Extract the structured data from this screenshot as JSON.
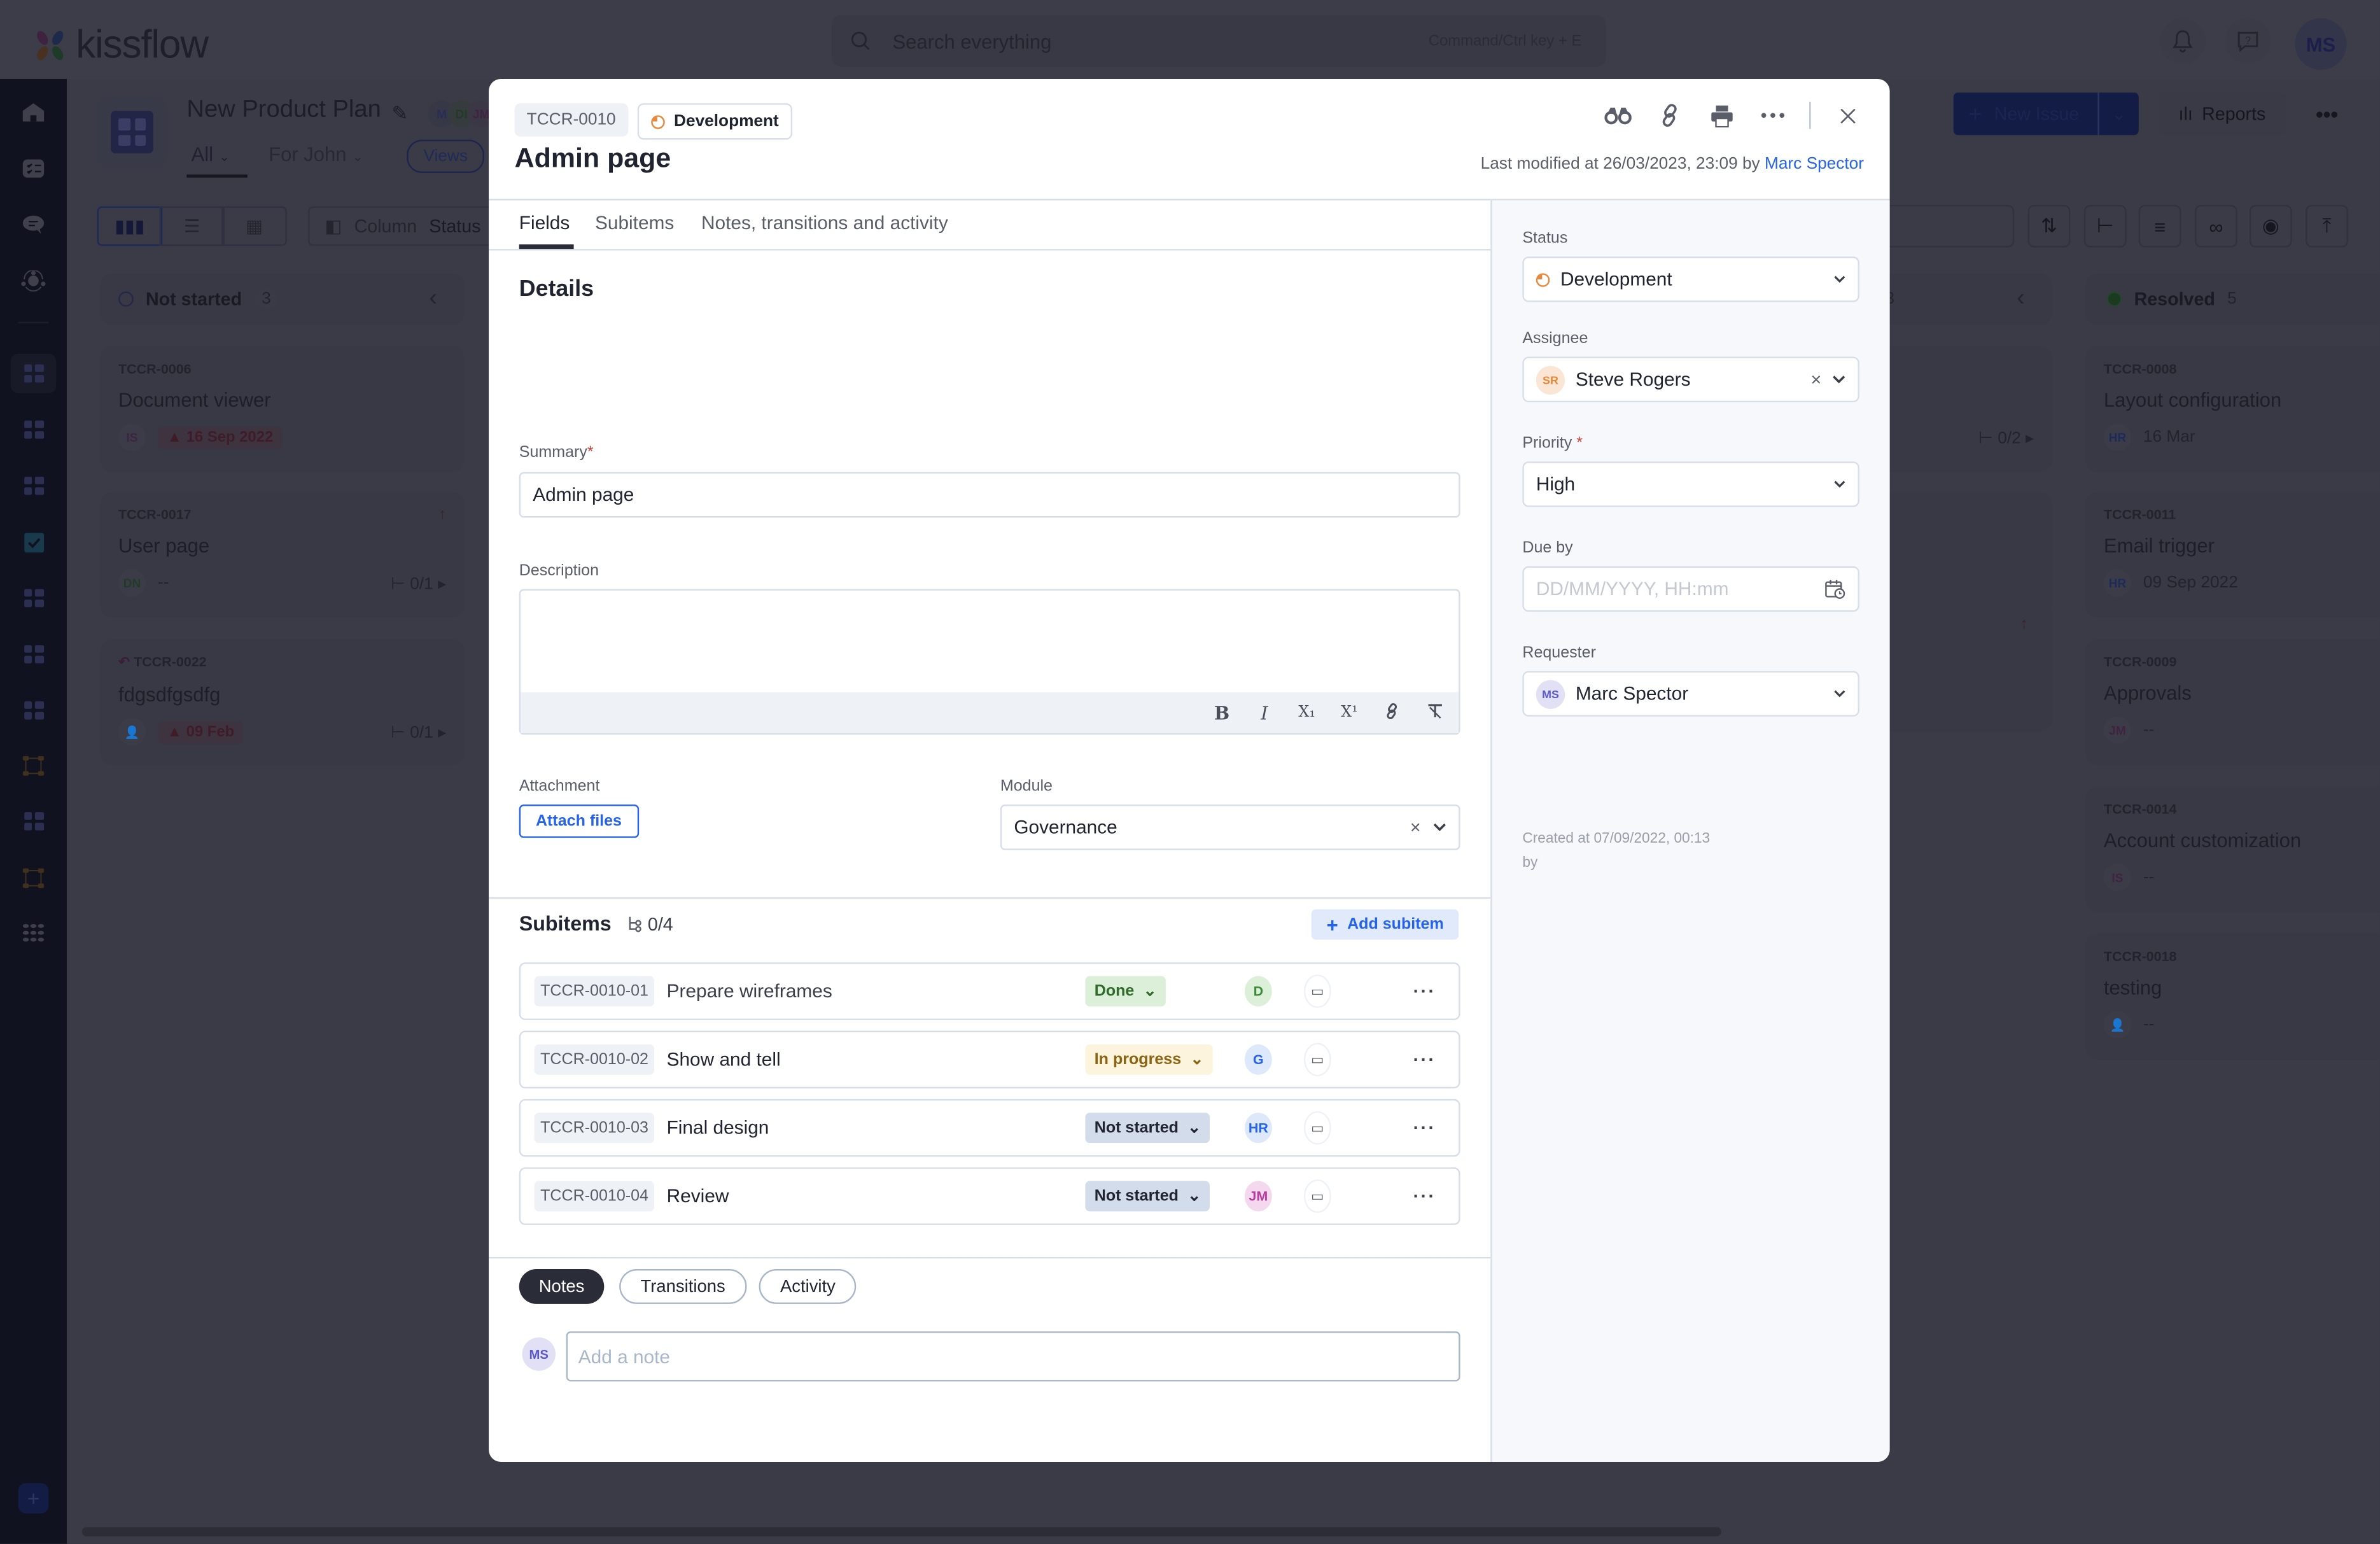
{
  "app": {
    "logo_text": "kissflow",
    "search_placeholder": "Search everything",
    "search_shortcut": "Command/Ctrl key + E",
    "user_initials": "MS",
    "icons": [
      "bell-icon",
      "help-icon"
    ]
  },
  "sidebar": {
    "items": [
      "home",
      "tasks",
      "chat",
      "community",
      "board",
      "board",
      "board",
      "checklist",
      "board",
      "board",
      "board",
      "process",
      "board",
      "process",
      "apps"
    ],
    "add_label": "+"
  },
  "background": {
    "board_title": "New Product Plan",
    "member_initials": [
      "M",
      "DI",
      "JM"
    ],
    "tabs": [
      "All",
      "For John"
    ],
    "views_label": "Views",
    "column_label": "Column",
    "column_value": "Status",
    "new_issue_label": "New Issue",
    "reports_label": "Reports",
    "columns": [
      {
        "name": "Not started",
        "count": "3",
        "cards": [
          {
            "id": "TCCR-0006",
            "title": "Document viewer",
            "assignee": "IS",
            "due": "16 Sep 2022",
            "overdue": true
          },
          {
            "id": "TCCR-0017",
            "title": "User page",
            "assignee": "DN",
            "due": "--",
            "subitems": "0/1",
            "priority_up": true
          },
          {
            "id": "TCCR-0022",
            "title": "fdgsdfgsdfg",
            "assignee": "",
            "due": "09 Feb",
            "overdue": true,
            "subitems": "0/1"
          }
        ]
      },
      {
        "name": "",
        "count": "3",
        "cards": [
          {
            "subitems": "0/2"
          }
        ]
      },
      {
        "name": "Resolved",
        "count": "5",
        "cards": [
          {
            "id": "TCCR-0008",
            "title": "Layout configuration",
            "assignee": "HR",
            "due": "16 Mar"
          },
          {
            "id": "TCCR-0011",
            "title": "Email trigger",
            "assignee": "HR",
            "due": "09 Sep 2022"
          },
          {
            "id": "TCCR-0009",
            "title": "Approvals",
            "assignee": "JM",
            "due": "--"
          },
          {
            "id": "TCCR-0014",
            "title": "Account customization",
            "assignee": "IS",
            "due": "--"
          },
          {
            "id": "TCCR-0018",
            "title": "testing",
            "assignee": "",
            "due": "--"
          }
        ]
      }
    ]
  },
  "modal": {
    "item_id": "TCCR-0010",
    "status_chip": "Development",
    "title": "Admin page",
    "last_modified_prefix": "Last modified at 26/03/2023, 23:09 by",
    "last_modified_by": "Marc Spector",
    "tabs": [
      "Fields",
      "Subitems",
      "Notes, transitions and activity"
    ],
    "active_tab": "Fields",
    "details_heading": "Details",
    "summary_label": "Summary",
    "summary_value": "Admin page",
    "description_label": "Description",
    "description_value": "",
    "editor_tools": [
      "B",
      "I",
      "X₁",
      "X¹",
      "link",
      "clear-format"
    ],
    "attachment_label": "Attachment",
    "attach_button": "Attach files",
    "module_label": "Module",
    "module_value": "Governance",
    "subitems_heading": "Subitems",
    "subitems_count": "0/4",
    "add_subitem": "Add subitem",
    "subitems": [
      {
        "id": "TCCR-0010-01",
        "name": "Prepare wireframes",
        "status": "Done",
        "assignee": "D"
      },
      {
        "id": "TCCR-0010-02",
        "name": "Show and tell",
        "status": "In progress",
        "assignee": "G"
      },
      {
        "id": "TCCR-0010-03",
        "name": "Final design",
        "status": "Not started",
        "assignee": "HR"
      },
      {
        "id": "TCCR-0010-04",
        "name": "Review",
        "status": "Not started",
        "assignee": "JM"
      }
    ],
    "activity_tabs": [
      "Notes",
      "Transitions",
      "Activity"
    ],
    "active_activity_tab": "Notes",
    "note_avatar": "MS",
    "note_placeholder": "Add a note",
    "side": {
      "status_label": "Status",
      "status_value": "Development",
      "assignee_label": "Assignee",
      "assignee_initials": "SR",
      "assignee_value": "Steve Rogers",
      "priority_label": "Priority",
      "priority_value": "High",
      "due_label": "Due by",
      "due_placeholder": "DD/MM/YYYY, HH:mm",
      "requester_label": "Requester",
      "requester_initials": "MS",
      "requester_value": "Marc Spector",
      "created_line1": "Created at 07/09/2022, 00:13",
      "created_line2": "by"
    }
  },
  "colors": {
    "accent": "#2563eb",
    "development": "#e6873a",
    "done_bg": "#dcefd8",
    "done_fg": "#2f6b2a",
    "inprogress_bg": "#fcf4dc",
    "inprogress_fg": "#8a6414",
    "notstarted_bg": "#d3dceb",
    "notstarted_fg": "#1f2430",
    "required": "#d0463b"
  }
}
